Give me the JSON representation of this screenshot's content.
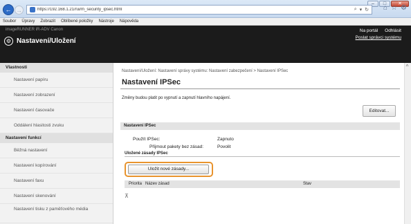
{
  "browser": {
    "window_controls": [
      "–",
      "□",
      "✕"
    ],
    "back_glyph": "←",
    "forward_glyph": "→",
    "url": "https://192.168.1.21/rui/m_security_ipsec.html",
    "address_tools": [
      "⌕",
      "▾",
      "↻"
    ],
    "tool_icons": [
      "⌂",
      "☆",
      "⚙"
    ],
    "menu": [
      "Soubor",
      "Úpravy",
      "Zobrazit",
      "Oblíbené položky",
      "Nástroje",
      "Nápověda"
    ]
  },
  "header": {
    "device_line": "imageRUNNER    iR-ADV    Canon",
    "logo_glyph": "⚙",
    "title": "Nastavení/Uložení",
    "links": [
      "Na portál",
      "Odhlásit"
    ],
    "mail_admin": "Poslat správci systému"
  },
  "sidebar": {
    "sections": [
      {
        "heading": "Vlastnosti",
        "items": [
          "Nastavení papíru",
          "Nastavení zobrazení",
          "Nastavení časovače",
          "Oddálení hlasitosti zvuku"
        ]
      },
      {
        "heading": "Nastavení funkcí",
        "items": [
          "Běžná nastavení",
          "Nastavení kopírování",
          "Nastavení faxu",
          "Nastavení skenování",
          "Nastavení tisku z paměťového média"
        ]
      }
    ]
  },
  "main": {
    "breadcrumb": "Nastavení/Uložení: Nastavení správy systému: Nastavení zabezpečení > Nastavení IPSec",
    "title": "Nastavení IPSec",
    "notice": "Změny budou platit po vypnutí a zapnutí hlavního napájení.",
    "edit_button": "Editovat...",
    "section_title": "Nastavení IPSec",
    "use_ipsec_label": "Použít IPSec:",
    "use_ipsec_value": "Zapnuto",
    "accept_label": "Přijmout pakety bez zásad:",
    "accept_value": "Povolit",
    "saved_policies_heading": "Uložené zásady IPSec",
    "new_policy_button": "Uložit nové zásady...",
    "table_columns": [
      "Priorita",
      "Název zásad",
      "Stav"
    ],
    "to_top_glyph": "⊼"
  },
  "colors": {
    "highlight": "#e8932d",
    "header_bg": "#1b1b1b",
    "back_button": "#2c6bc7"
  }
}
